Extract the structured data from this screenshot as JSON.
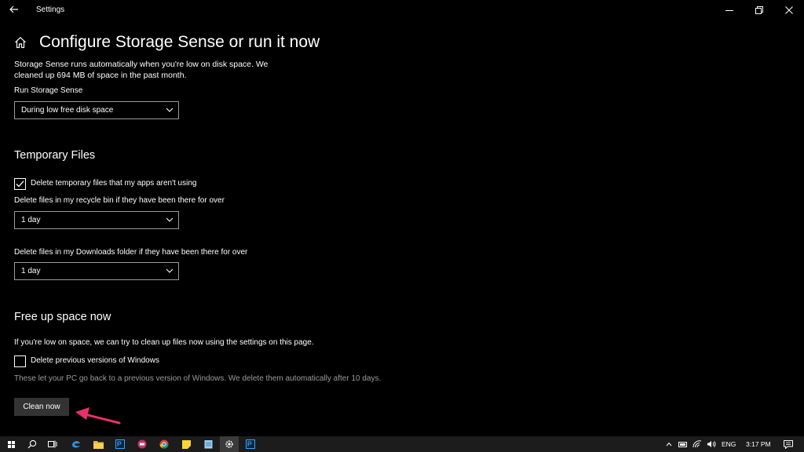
{
  "window": {
    "title": "Settings"
  },
  "page": {
    "title": "Configure Storage Sense or run it now",
    "description": "Storage Sense runs automatically when you're low on disk space. We cleaned up 694 MB of space in the past month.",
    "run_label": "Run Storage Sense",
    "run_value": "During low free disk space"
  },
  "temporary_files": {
    "title": "Temporary Files",
    "delete_temp_label": "Delete temporary files that my apps aren't using",
    "delete_temp_checked": true,
    "recycle_label": "Delete files in my recycle bin if they have been there for over",
    "recycle_value": "1 day",
    "downloads_label": "Delete files in my Downloads folder if they have been there for over",
    "downloads_value": "1 day"
  },
  "free_up": {
    "title": "Free up space now",
    "description": "If you're low on space, we can try to clean up files now using the settings on this page.",
    "prev_windows_label": "Delete previous versions of Windows",
    "prev_windows_checked": false,
    "prev_windows_note": "These let your PC go back to a previous version of Windows. We delete them automatically after 10 days.",
    "clean_button": "Clean now"
  },
  "taskbar": {
    "apps": [
      "start-icon",
      "search-icon",
      "task-view-icon",
      "edge-icon",
      "file-explorer-icon",
      "photoshop-icon",
      "app-icon",
      "chrome-icon",
      "sticky-notes-icon",
      "notepad-icon",
      "settings-icon",
      "photoshop-icon"
    ],
    "language": "ENG",
    "time": "3:17 PM"
  },
  "colors": {
    "accent_arrow": "#e8306a",
    "button_bg": "#333333",
    "taskbar_bg": "#1c1c1c"
  }
}
